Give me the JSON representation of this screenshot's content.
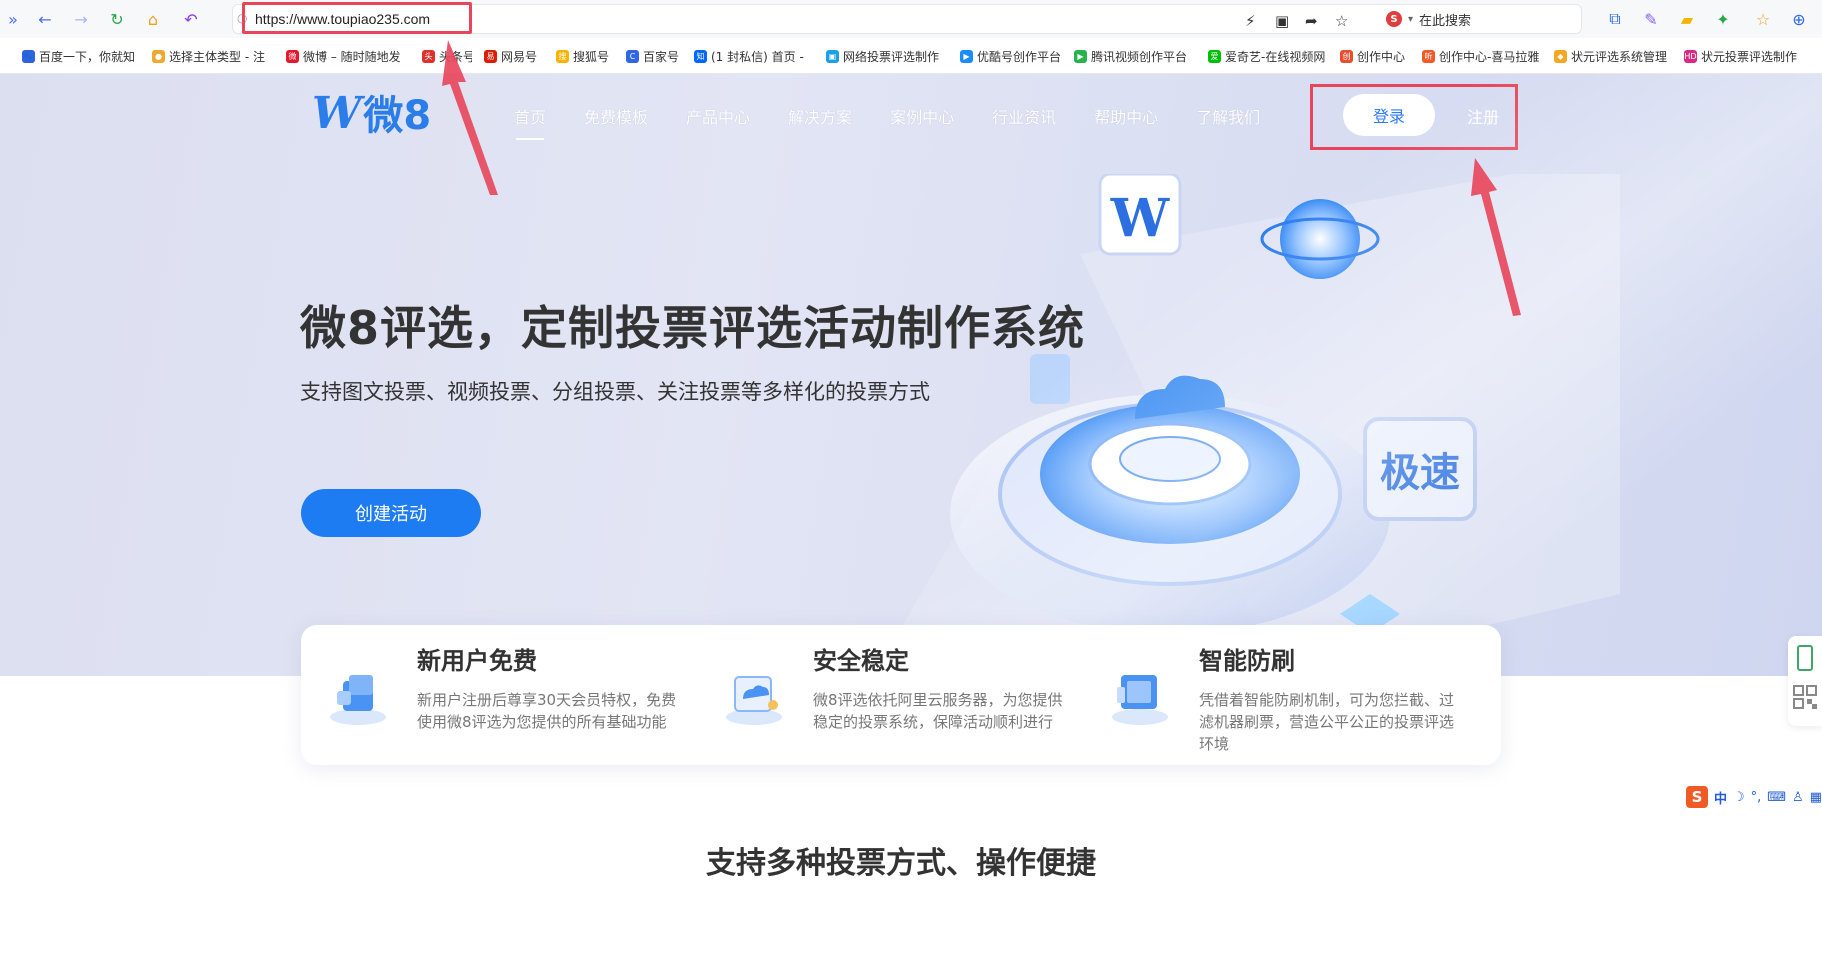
{
  "browser": {
    "url": "https://www.toupiao235.com",
    "search_placeholder": "在此搜索",
    "bookmarks": [
      {
        "label": "百度一下，你就知",
        "color": "#2d63e0",
        "glyph": "🐾"
      },
      {
        "label": "选择主体类型 - 注",
        "color": "#f0a830",
        "glyph": "●"
      },
      {
        "label": "微博 – 随时随地发",
        "color": "#e6162d",
        "glyph": "微"
      },
      {
        "label": "头条号",
        "color": "#e0302d",
        "glyph": "头"
      },
      {
        "label": "网易号",
        "color": "#d81e06",
        "glyph": "易"
      },
      {
        "label": "搜狐号",
        "color": "#f5b400",
        "glyph": "搜"
      },
      {
        "label": "百家号",
        "color": "#2e66e6",
        "glyph": "C"
      },
      {
        "label": "(1 封私信) 首页 -",
        "color": "#0066ff",
        "glyph": "知"
      },
      {
        "label": "网络投票评选制作",
        "color": "#1aa0e8",
        "glyph": "▣"
      },
      {
        "label": "优酷号创作平台",
        "color": "#1a8cff",
        "glyph": "▶"
      },
      {
        "label": "腾讯视频创作平台",
        "color": "#26b34a",
        "glyph": "▶"
      },
      {
        "label": "爱奇艺-在线视频网",
        "color": "#00be06",
        "glyph": "爱"
      },
      {
        "label": "创作中心",
        "color": "#e94c2f",
        "glyph": "创"
      },
      {
        "label": "创作中心-喜马拉雅",
        "color": "#f25a28",
        "glyph": "听"
      },
      {
        "label": "状元评选系统管理",
        "color": "#f5a623",
        "glyph": "◆"
      },
      {
        "label": "状元投票评选制作",
        "color": "#d92b86",
        "glyph": "HD"
      }
    ]
  },
  "site": {
    "logo_text": "微8",
    "logo_mark": "W",
    "nav": [
      "首页",
      "免费模板",
      "产品中心",
      "解决方案",
      "案例中心",
      "行业资讯",
      "帮助中心",
      "了解我们"
    ],
    "login": "登录",
    "register": "注册",
    "hero_title": "微8评选，定制投票评选活动制作系统",
    "hero_subtitle": "支持图文投票、视频投票、分组投票、关注投票等多样化的投票方式",
    "cta": "创建活动",
    "art_badge": "极速",
    "features": [
      {
        "title": "新用户免费",
        "desc": "新用户注册后尊享30天会员特权，免费使用微8评选为您提供的所有基础功能"
      },
      {
        "title": "安全稳定",
        "desc": "微8评选依托阿里云服务器，为您提供稳定的投票系统，保障活动顺利进行"
      },
      {
        "title": "智能防刷",
        "desc": "凭借着智能防刷机制，可为您拦截、过滤机器刷票，营造公平公正的投票评选环境"
      }
    ],
    "section_title": "支持多种投票方式、操作便捷"
  },
  "ime": {
    "logo": "S",
    "mode": "中"
  },
  "colors": {
    "accent": "#1e7cf2",
    "annotation": "#e8455a"
  }
}
